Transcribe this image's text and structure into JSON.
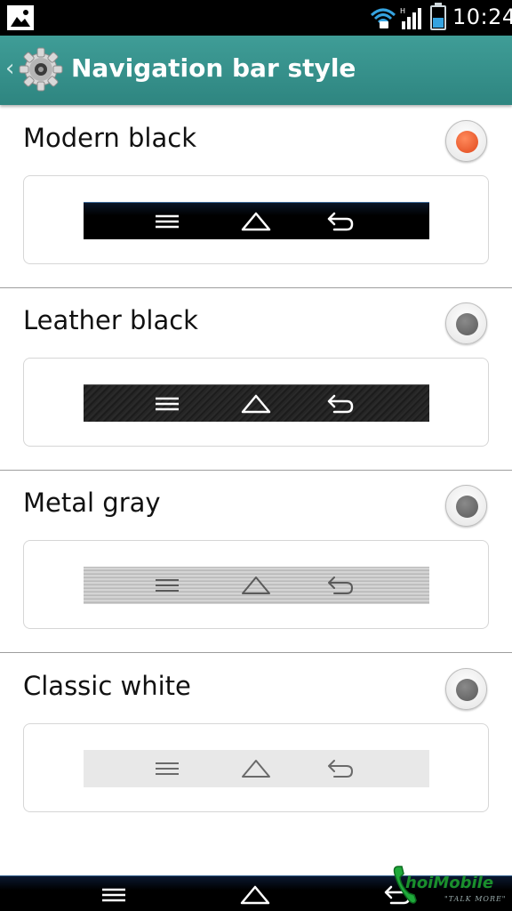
{
  "status_bar": {
    "time": "10:24",
    "icons": [
      "gallery-notification-icon",
      "wifi-icon",
      "signal-icon",
      "battery-icon"
    ],
    "battery_color": "#35a3e0"
  },
  "action_bar": {
    "title": "Navigation bar style",
    "up_glyph": "‹",
    "background": "#368f8a",
    "app_icon": "settings-gear-icon"
  },
  "options": [
    {
      "label": "Modern black",
      "selected": true,
      "style": "modern-black"
    },
    {
      "label": "Leather black",
      "selected": false,
      "style": "leather-black"
    },
    {
      "label": "Metal gray",
      "selected": false,
      "style": "metal-gray"
    },
    {
      "label": "Classic white",
      "selected": false,
      "style": "classic-white"
    }
  ],
  "colors": {
    "radio_selected": "#e0481c",
    "radio_unselected": "#6a6a6a"
  },
  "system_nav": {
    "icons": [
      "menu-icon",
      "home-icon",
      "back-icon"
    ]
  },
  "watermark": {
    "brand": "hoiMobile",
    "tagline": "\"TALK MORE\""
  }
}
